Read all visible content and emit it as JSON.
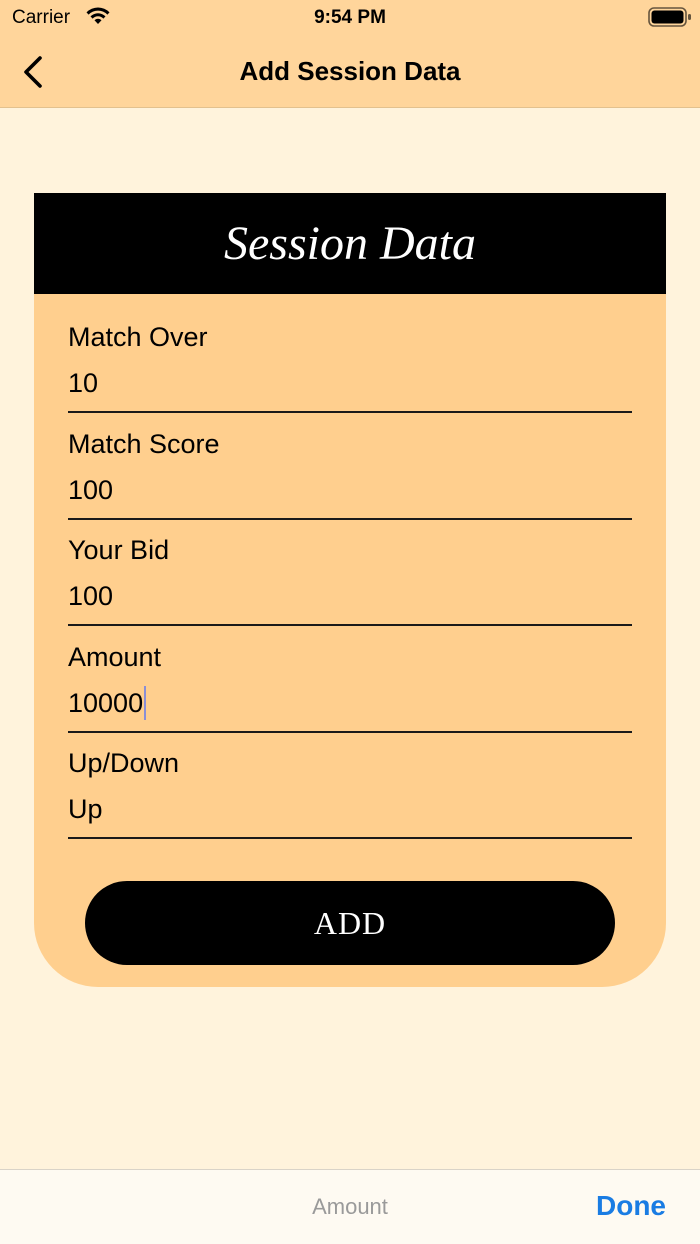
{
  "status_bar": {
    "carrier": "Carrier",
    "time": "9:54 PM",
    "wifi_icon": "wifi-icon",
    "battery_icon": "battery-icon"
  },
  "nav": {
    "title": "Add Session Data",
    "back_icon": "chevron-left-icon"
  },
  "card": {
    "title": "Session Data",
    "fields": [
      {
        "label": "Match Over",
        "value": "10"
      },
      {
        "label": "Match Score",
        "value": "100"
      },
      {
        "label": "Your Bid",
        "value": "100"
      },
      {
        "label": "Amount",
        "value": "10000"
      },
      {
        "label": "Up/Down",
        "value": "Up"
      }
    ],
    "add_label": "ADD"
  },
  "toolbar": {
    "title": "Amount",
    "done_label": "Done"
  },
  "colors": {
    "bar_background": "#ffd59b",
    "page_background": "#fff3dc",
    "card_background": "#ffcf8e",
    "header_background": "#000000",
    "done_blue": "#1a7ce3"
  }
}
